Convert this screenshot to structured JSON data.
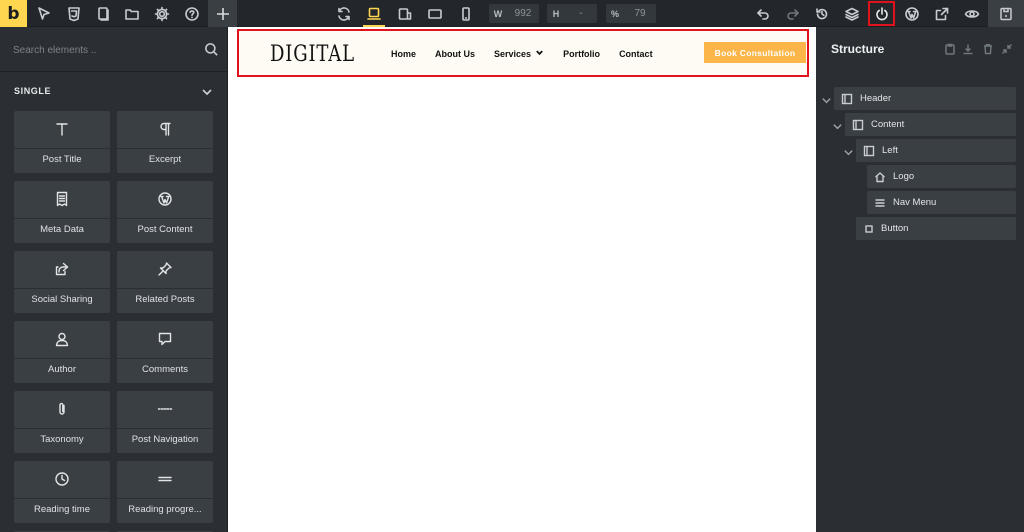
{
  "toolbar": {
    "brand_letter": "b",
    "width_label": "W",
    "width_value": "992",
    "height_label": "H",
    "height_value": "-",
    "zoom_label": "%",
    "zoom_value": "79"
  },
  "left_panel": {
    "search_placeholder": "Search elements ..",
    "category": "SINGLE",
    "elements": [
      {
        "label": "Post Title",
        "icon": "text-icon"
      },
      {
        "label": "Excerpt",
        "icon": "paragraph-icon"
      },
      {
        "label": "Meta Data",
        "icon": "receipt-icon"
      },
      {
        "label": "Post Content",
        "icon": "wordpress-icon"
      },
      {
        "label": "Social Sharing",
        "icon": "share-icon"
      },
      {
        "label": "Related Posts",
        "icon": "pin-icon"
      },
      {
        "label": "Author",
        "icon": "user-icon"
      },
      {
        "label": "Comments",
        "icon": "comment-icon"
      },
      {
        "label": "Taxonomy",
        "icon": "paperclip-icon"
      },
      {
        "label": "Post Navigation",
        "icon": "dots-icon"
      },
      {
        "label": "Reading time",
        "icon": "clock-icon"
      },
      {
        "label": "Reading progre...",
        "icon": "bars-icon"
      }
    ]
  },
  "canvas": {
    "site_logo": "DIGITAL",
    "nav_items": [
      "Home",
      "About Us",
      "Services",
      "Portfolio",
      "Contact"
    ],
    "cta_button": "Book Consultation",
    "cta_color": "#fbb549",
    "highlight_color": "#e0121b"
  },
  "structure": {
    "title": "Structure",
    "tree": [
      {
        "label": "Header",
        "icon": "section-icon"
      },
      {
        "label": "Content",
        "icon": "section-icon"
      },
      {
        "label": "Left",
        "icon": "section-icon"
      },
      {
        "label": "Logo",
        "icon": "home-icon"
      },
      {
        "label": "Nav Menu",
        "icon": "menu-icon"
      },
      {
        "label": "Button",
        "icon": "square-icon"
      }
    ]
  },
  "colors": {
    "accent": "#ffd64f",
    "panel_bg": "#2b2f33",
    "card_bg": "#3a3f44"
  }
}
